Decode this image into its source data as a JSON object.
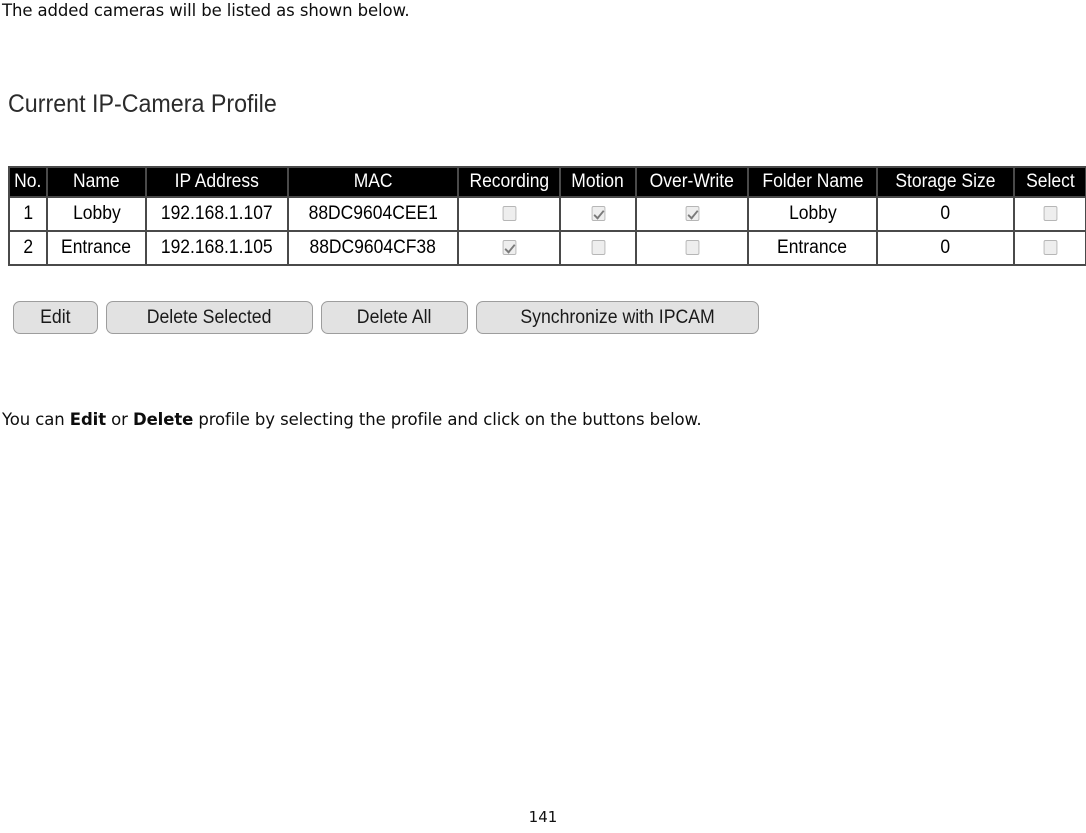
{
  "intro_text": "The added cameras will be listed as shown below.",
  "section": {
    "heading": "Current IP-Camera Profile"
  },
  "table": {
    "columns": [
      "No.",
      "Name",
      "IP Address",
      "MAC",
      "Recording",
      "Motion",
      "Over-Write",
      "Folder Name",
      "Storage Size",
      "Select"
    ],
    "rows": [
      {
        "no": "1",
        "name": "Lobby",
        "ip": "192.168.1.107",
        "mac": "88DC9604CEE1",
        "recording": false,
        "motion": true,
        "over_write": true,
        "folder_name": "Lobby",
        "storage_size": "0",
        "select": false
      },
      {
        "no": "2",
        "name": "Entrance",
        "ip": "192.168.1.105",
        "mac": "88DC9604CF38",
        "recording": true,
        "motion": false,
        "over_write": false,
        "folder_name": "Entrance",
        "storage_size": "0",
        "select": false
      }
    ]
  },
  "buttons": {
    "edit": "Edit",
    "delete_selected": "Delete Selected",
    "delete_all": "Delete All",
    "synchronize": "Synchronize with IPCAM"
  },
  "outro": {
    "part1": "You can ",
    "bold1": "Edit",
    "part2": " or ",
    "bold2": "Delete",
    "part3": " profile by selecting the profile and click on the buttons below."
  },
  "page_number": "141",
  "colors": {
    "header_background": "#000000",
    "header_text": "#ffffff",
    "table_border": "#4a4a4a",
    "button_face": "#e2e2e2",
    "button_border": "#9d9d9d",
    "checkbox_face": "#eeeeee",
    "check_mark": "#7a7a7a"
  }
}
